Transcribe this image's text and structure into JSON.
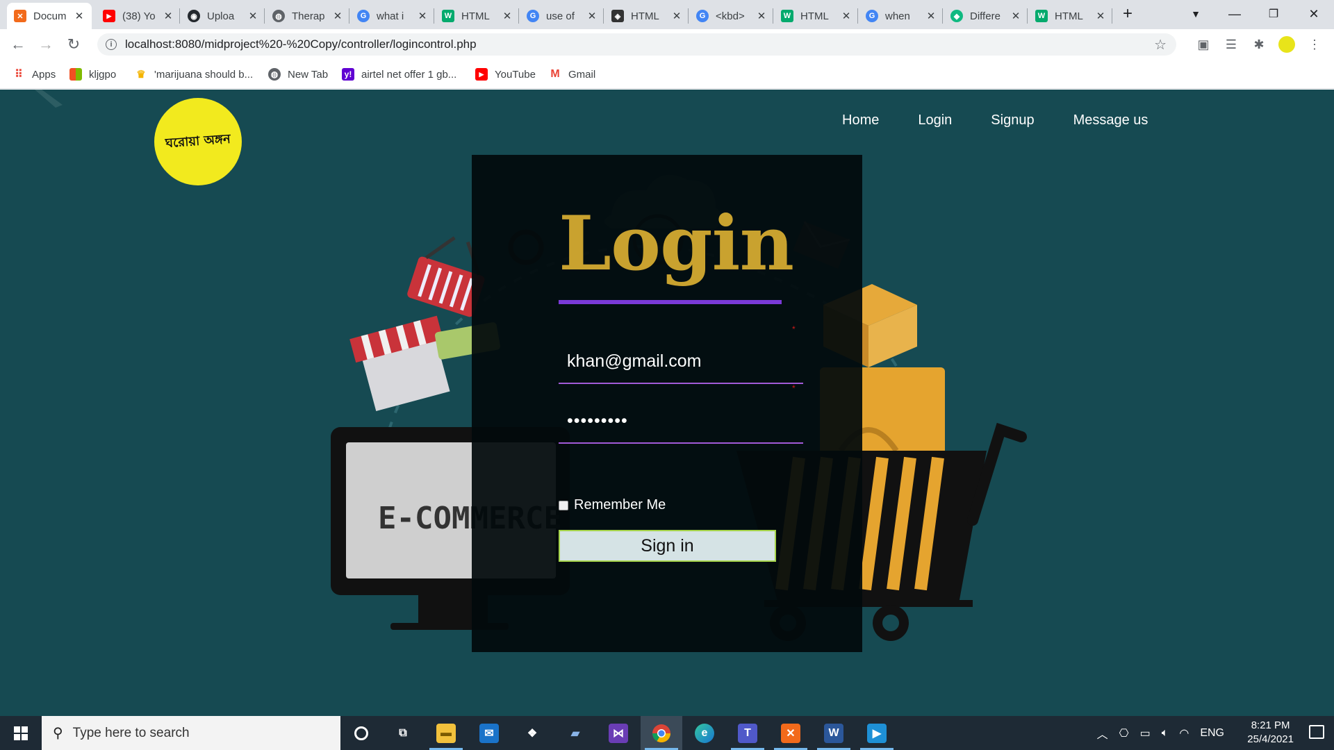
{
  "tabs": [
    {
      "title": "Docum",
      "favicon": "xampp-icon",
      "color": "#f26a1b",
      "active": true
    },
    {
      "title": "(38) Yo",
      "favicon": "youtube-icon",
      "color": "#ff0000"
    },
    {
      "title": "Uploa",
      "favicon": "github-icon",
      "color": "#24292e"
    },
    {
      "title": "Therap",
      "favicon": "globe-icon",
      "color": "#5f6368"
    },
    {
      "title": "what i",
      "favicon": "google-icon",
      "color": "#4285f4"
    },
    {
      "title": "HTML",
      "favicon": "w3schools-icon",
      "color": "#04aa6d"
    },
    {
      "title": "use of",
      "favicon": "google-icon",
      "color": "#4285f4"
    },
    {
      "title": "HTML",
      "favicon": "devdocs-icon",
      "color": "#333333"
    },
    {
      "title": "<kbd>",
      "favicon": "google-icon",
      "color": "#4285f4"
    },
    {
      "title": "HTML",
      "favicon": "w3schools-icon",
      "color": "#04aa6d"
    },
    {
      "title": "when",
      "favicon": "google-icon",
      "color": "#4285f4"
    },
    {
      "title": "Differe",
      "favicon": "shield-icon",
      "color": "#10b981"
    },
    {
      "title": "HTML",
      "favicon": "w3schools-icon",
      "color": "#04aa6d"
    }
  ],
  "address_bar": {
    "url": "localhost:8080/midproject%20-%20Copy/controller/logincontrol.php"
  },
  "bookmarks": [
    {
      "label": "Apps",
      "icon": "apps-grid-icon",
      "color": "#ea4335"
    },
    {
      "label": "kljgpo",
      "icon": "microsoft-icon",
      "color": "#f25022"
    },
    {
      "label": "'marijuana should b...",
      "icon": "trophy-icon",
      "color": "#f4b400"
    },
    {
      "label": "New Tab",
      "icon": "globe-icon",
      "color": "#5f6368"
    },
    {
      "label": "airtel net offer 1 gb...",
      "icon": "yahoo-icon",
      "color": "#6001d2"
    },
    {
      "label": "YouTube",
      "icon": "youtube-icon",
      "color": "#ff0000"
    },
    {
      "label": "Gmail",
      "icon": "gmail-icon",
      "color": "#ea4335"
    }
  ],
  "site": {
    "logo_text": "ঘরোয়া অঙ্গন",
    "nav": [
      "Home",
      "Login",
      "Signup",
      "Message us"
    ],
    "background_text": "E-COMMERCE",
    "login": {
      "title": "Login",
      "email_value": "khan@gmail.com",
      "password_value": "•••••••••",
      "remember_label": "Remember Me",
      "signin_label": "Sign in"
    },
    "colors": {
      "page_background": "#164a52",
      "title_gold": "#c9a22f",
      "underline_purple": "#7a3ad8",
      "logo_yellow": "#f2ea1e"
    }
  },
  "taskbar": {
    "search_placeholder": "Type here to search",
    "apps": [
      "cortana-icon",
      "task-view-icon",
      "file-explorer-icon",
      "mail-icon",
      "dropbox-icon",
      "user-folder-icon",
      "visual-studio-icon",
      "chrome-icon",
      "edge-icon",
      "teams-icon",
      "xampp-icon",
      "word-icon",
      "video-icon"
    ],
    "language": "ENG",
    "time": "8:21 PM",
    "date": "25/4/2021"
  }
}
